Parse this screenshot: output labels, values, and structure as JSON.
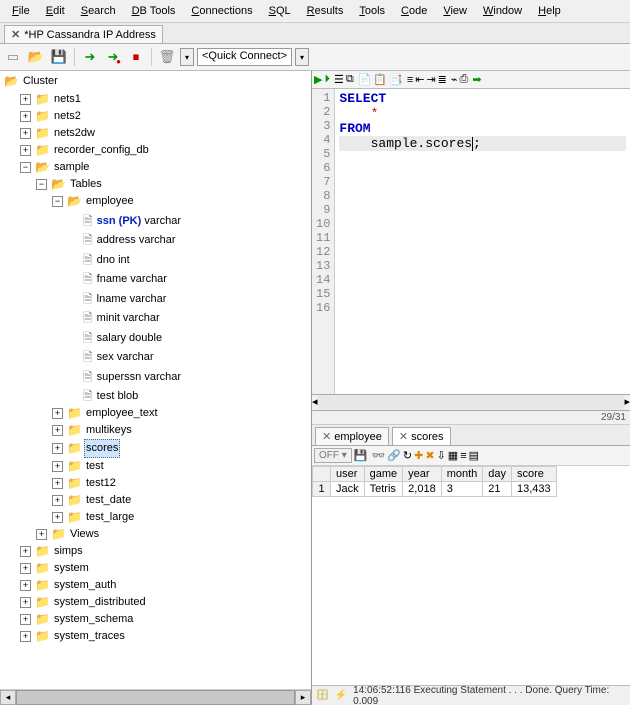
{
  "menu": {
    "items": [
      "File",
      "Edit",
      "Search",
      "DB Tools",
      "Connections",
      "SQL",
      "Results",
      "Tools",
      "Code",
      "View",
      "Window",
      "Help"
    ]
  },
  "document_tab": {
    "title": "*HP Cassandra IP Address"
  },
  "quick_connect": "<Quick Connect>",
  "tree": {
    "root": "Cluster",
    "keyspaces": [
      "nets1",
      "nets2",
      "nets2dw",
      "recorder_config_db"
    ],
    "sample": {
      "name": "sample",
      "tables_label": "Tables",
      "employee": {
        "name": "employee",
        "columns": [
          {
            "name": "ssn",
            "pk": true,
            "type": "varchar"
          },
          {
            "name": "address",
            "pk": false,
            "type": "varchar"
          },
          {
            "name": "dno",
            "pk": false,
            "type": "int"
          },
          {
            "name": "fname",
            "pk": false,
            "type": "varchar"
          },
          {
            "name": "lname",
            "pk": false,
            "type": "varchar"
          },
          {
            "name": "minit",
            "pk": false,
            "type": "varchar"
          },
          {
            "name": "salary",
            "pk": false,
            "type": "double"
          },
          {
            "name": "sex",
            "pk": false,
            "type": "varchar"
          },
          {
            "name": "superssn",
            "pk": false,
            "type": "varchar"
          },
          {
            "name": "test",
            "pk": false,
            "type": "blob"
          }
        ]
      },
      "other_tables": [
        "employee_text",
        "multikeys",
        "scores",
        "test",
        "test12",
        "test_date",
        "test_large"
      ],
      "selected_table": "scores",
      "views_label": "Views"
    },
    "more_keyspaces": [
      "simps",
      "system",
      "system_auth",
      "system_distributed",
      "system_schema",
      "system_traces"
    ]
  },
  "editor": {
    "lines_count": 16,
    "sql": {
      "l1": "SELECT",
      "l2": "*",
      "l3": "FROM",
      "l4a": "sample.scores",
      "l4b": ";"
    },
    "cursor_status": "29/31"
  },
  "results": {
    "tabs": [
      "employee",
      "scores"
    ],
    "active_tab": 1,
    "off_label": "OFF",
    "columns": [
      "user",
      "game",
      "year",
      "month",
      "day",
      "score"
    ],
    "rows": [
      {
        "user": "Jack",
        "game": "Tetris",
        "year": "2,018",
        "month": "3",
        "day": "21",
        "score": "13,433"
      }
    ]
  },
  "status": {
    "text": "14:06:52:116 Executing Statement . . . Done. Query Time: 0.009"
  }
}
